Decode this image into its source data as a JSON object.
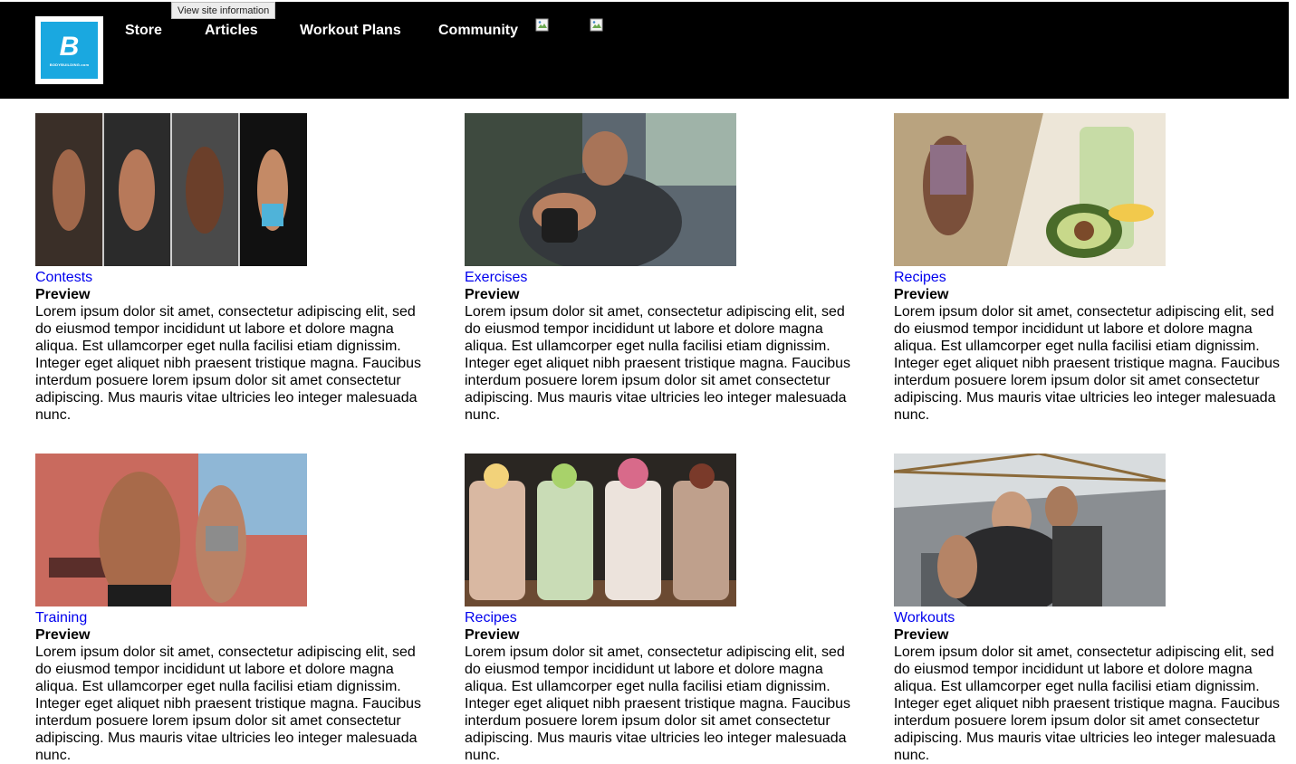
{
  "nav": {
    "logo_text": "BODYBUILDING.com",
    "links": [
      "Store",
      "Articles",
      "Workout Plans",
      "Community"
    ],
    "tooltip": "View site information"
  },
  "cards": [
    {
      "category": "Contests",
      "heading": "Preview",
      "image": "contests-photo",
      "body": "Lorem ipsum dolor sit amet, consectetur adipiscing elit, sed do eiusmod tempor incididunt ut labore et dolore magna aliqua. Est ullamcorper eget nulla facilisi etiam dignissim. Integer eget aliquet nibh praesent tristique magna. Faucibus interdum posuere lorem ipsum dolor sit amet consectetur adipiscing. Mus mauris vitae ultricies leo integer malesuada nunc."
    },
    {
      "category": "Exercises",
      "heading": "Preview",
      "image": "exercises-photo",
      "body": "Lorem ipsum dolor sit amet, consectetur adipiscing elit, sed do eiusmod tempor incididunt ut labore et dolore magna aliqua. Est ullamcorper eget nulla facilisi etiam dignissim. Integer eget aliquet nibh praesent tristique magna. Faucibus interdum posuere lorem ipsum dolor sit amet consectetur adipiscing. Mus mauris vitae ultricies leo integer malesuada nunc."
    },
    {
      "category": "Recipes",
      "heading": "Preview",
      "image": "recipes-photo",
      "body": "Lorem ipsum dolor sit amet, consectetur adipiscing elit, sed do eiusmod tempor incididunt ut labore et dolore magna aliqua. Est ullamcorper eget nulla facilisi etiam dignissim. Integer eget aliquet nibh praesent tristique magna. Faucibus interdum posuere lorem ipsum dolor sit amet consectetur adipiscing. Mus mauris vitae ultricies leo integer malesuada nunc."
    },
    {
      "category": "Training",
      "heading": "Preview",
      "image": "training-photo",
      "body": "Lorem ipsum dolor sit amet, consectetur adipiscing elit, sed do eiusmod tempor incididunt ut labore et dolore magna aliqua. Est ullamcorper eget nulla facilisi etiam dignissim. Integer eget aliquet nibh praesent tristique magna. Faucibus interdum posuere lorem ipsum dolor sit amet consectetur adipiscing. Mus mauris vitae ultricies leo integer malesuada nunc."
    },
    {
      "category": "Recipes",
      "heading": "Preview",
      "image": "shakes-photo",
      "body": "Lorem ipsum dolor sit amet, consectetur adipiscing elit, sed do eiusmod tempor incididunt ut labore et dolore magna aliqua. Est ullamcorper eget nulla facilisi etiam dignissim. Integer eget aliquet nibh praesent tristique magna. Faucibus interdum posuere lorem ipsum dolor sit amet consectetur adipiscing. Mus mauris vitae ultricies leo integer malesuada nunc."
    },
    {
      "category": "Workouts",
      "heading": "Preview",
      "image": "workouts-photo",
      "body": "Lorem ipsum dolor sit amet, consectetur adipiscing elit, sed do eiusmod tempor incididunt ut labore et dolore magna aliqua. Est ullamcorper eget nulla facilisi etiam dignissim. Integer eget aliquet nibh praesent tristique magna. Faucibus interdum posuere lorem ipsum dolor sit amet consectetur adipiscing. Mus mauris vitae ultricies leo integer malesuada nunc."
    }
  ]
}
